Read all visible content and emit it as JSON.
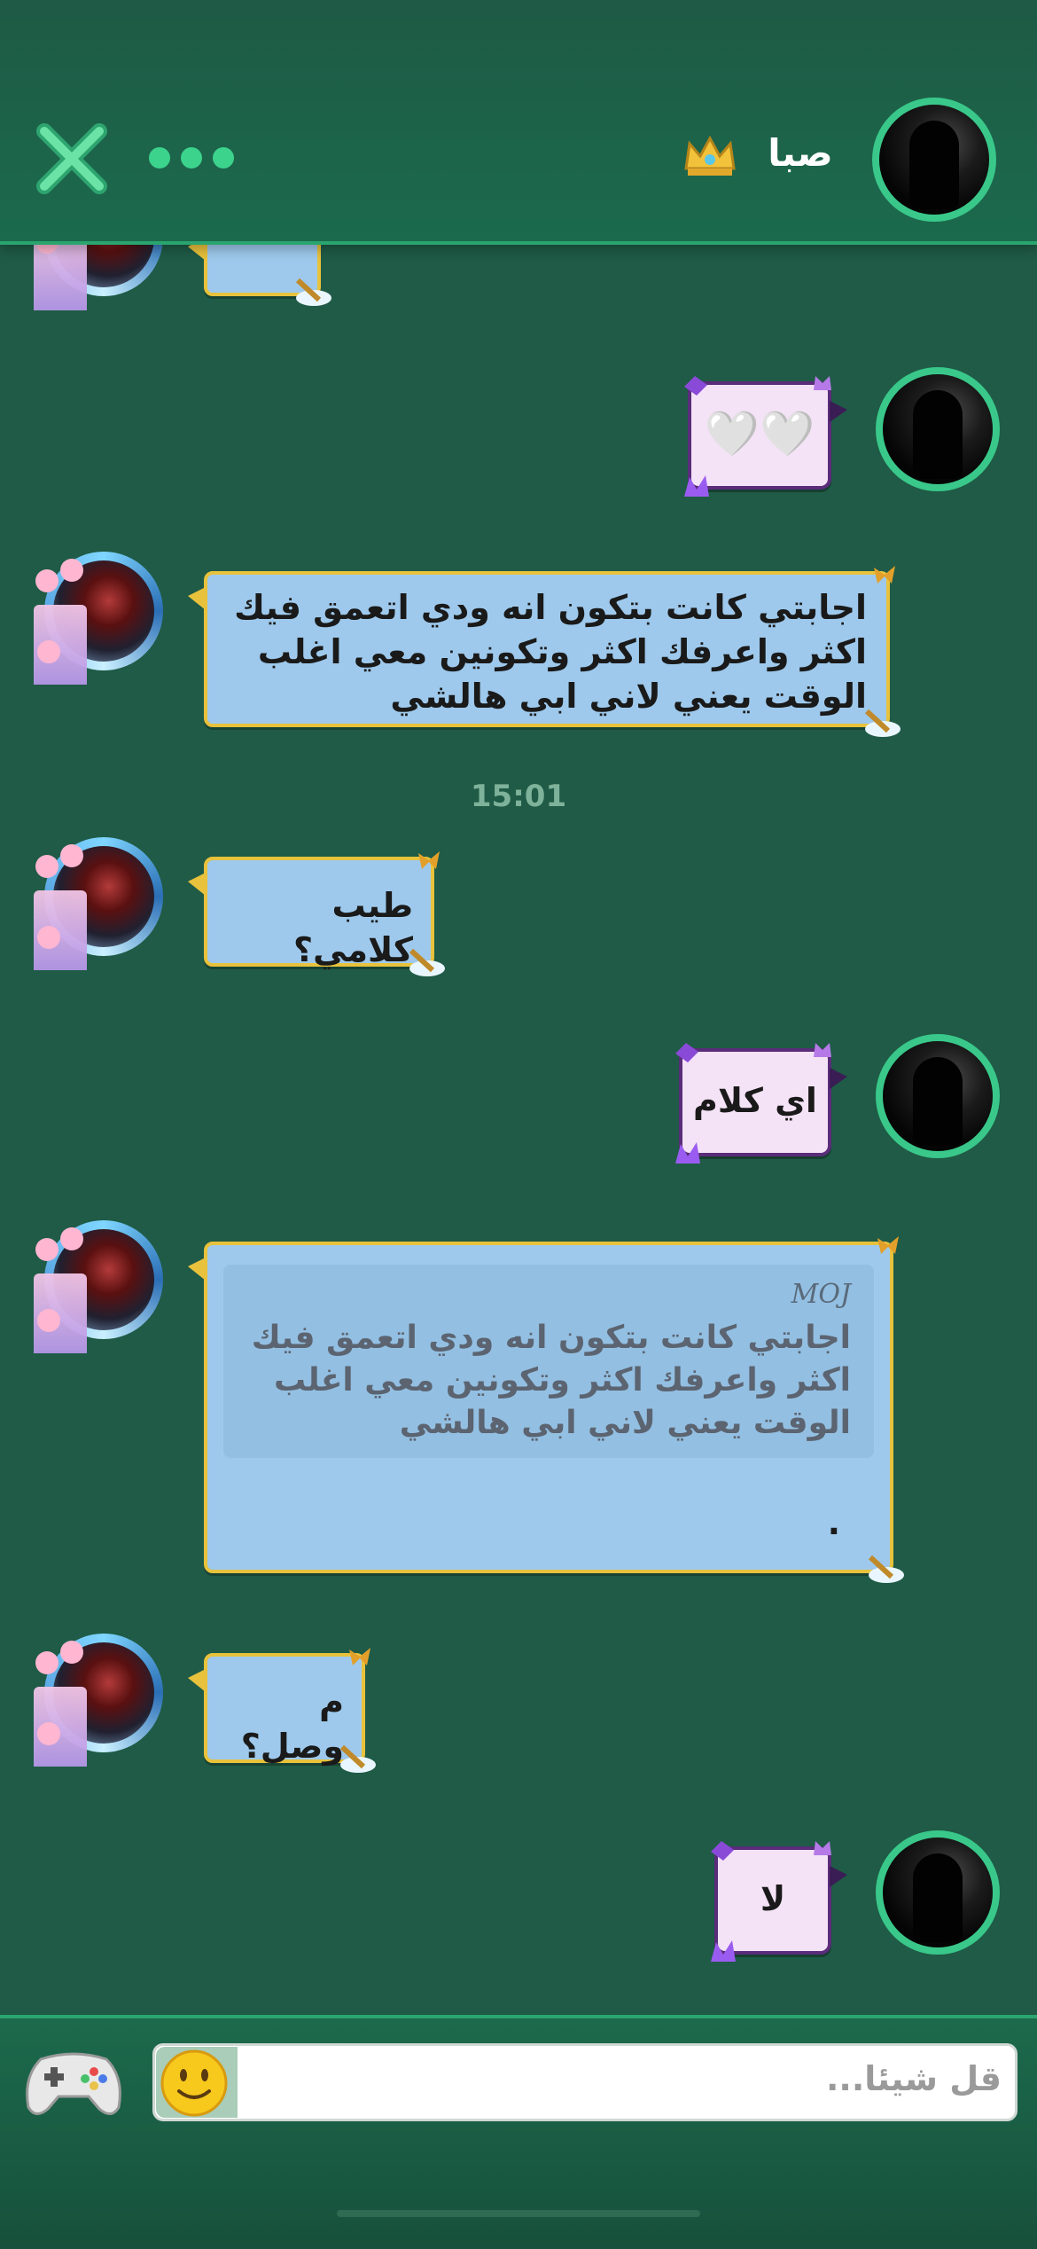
{
  "header": {
    "contact_name": "صبا",
    "close_icon": "close-x-icon",
    "more_icon": "more-dots-icon",
    "crown_icon": "crown-icon"
  },
  "messages": [
    {
      "from": "other",
      "text": ""
    },
    {
      "from": "me",
      "text": "🤍🤍"
    },
    {
      "from": "other",
      "text": "اجابتي كانت بتكون انه ودي اتعمق فيك اكثر واعرفك اكثر وتكونين معي اغلب الوقت يعني لاني ابي هالشي"
    },
    {
      "from": "other",
      "text": "طيب كلامي؟"
    },
    {
      "from": "me",
      "text": "اي كلام"
    },
    {
      "from": "other",
      "quote_name": "MOJ",
      "quote_text": "اجابتي كانت بتكون انه ودي اتعمق فيك اكثر واعرفك اكثر وتكونين معي اغلب الوقت يعني لاني ابي هالشي",
      "text": "."
    },
    {
      "from": "other",
      "text": "م وصل؟"
    },
    {
      "from": "me",
      "text": "لا"
    }
  ],
  "timestamp": "15:01",
  "footer": {
    "input_placeholder": "قل شيئا...",
    "gamepad_icon": "gamepad-icon",
    "emoji_icon": "emoji-smile-icon"
  },
  "colors": {
    "background": "#1f5b46",
    "accent_green": "#39c88a",
    "other_bubble": "#9ec9ec",
    "other_border": "#e8c23c",
    "me_bubble": "#f4e2f6",
    "me_border": "#5a2c7a"
  }
}
